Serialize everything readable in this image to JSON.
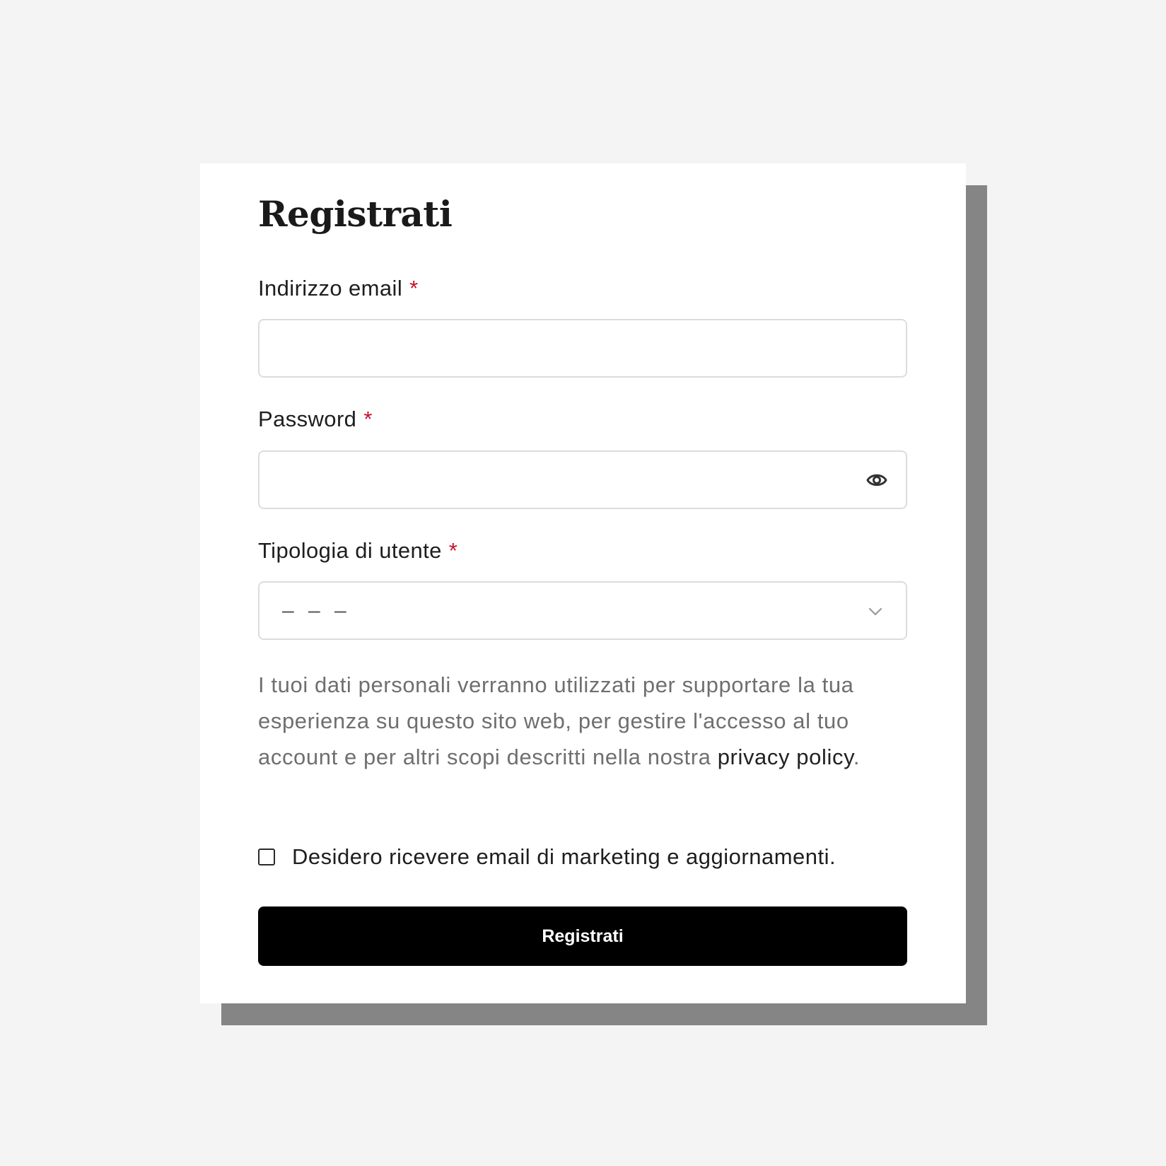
{
  "form": {
    "title": "Registrati",
    "email": {
      "label": "Indirizzo email",
      "required_mark": "*",
      "value": "",
      "placeholder": ""
    },
    "password": {
      "label": "Password",
      "required_mark": "*",
      "value": "",
      "placeholder": "",
      "toggle_icon": "eye-icon"
    },
    "user_type": {
      "label": "Tipologia di utente",
      "required_mark": "*",
      "selected": "– – –",
      "dropdown_icon": "chevron-down-icon"
    },
    "privacy_notice": {
      "text": "I tuoi dati personali verranno utilizzati per supportare la tua esperienza su questo sito web, per gestire l'accesso al tuo account e per altri scopi descritti nella nostra ",
      "link_text": "privacy policy",
      "suffix": "."
    },
    "marketing_opt_in": {
      "label": "Desidero ricevere email di marketing e aggiornamenti.",
      "checked": false
    },
    "submit_label": "Registrati"
  },
  "colors": {
    "background": "#f4f4f4",
    "card": "#ffffff",
    "card_shadow": "#858585",
    "required": "#c8102e",
    "button": "#000000",
    "button_text": "#ffffff",
    "muted_text": "#6f6f6f"
  }
}
